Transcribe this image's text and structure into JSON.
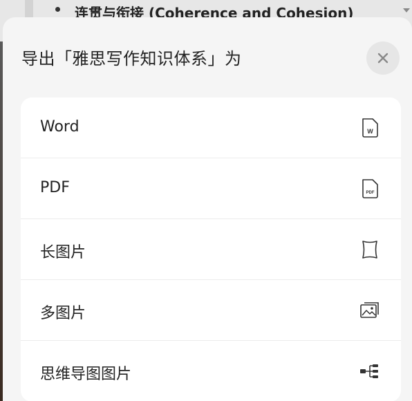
{
  "background": {
    "outline_item": "连贯与衔接 (Coherence and Cohesion)"
  },
  "sheet": {
    "title": "导出「雅思写作知识体系」为",
    "close_icon": "close-icon",
    "options": [
      {
        "label": "Word",
        "icon": "word-file-icon",
        "icon_text": "W"
      },
      {
        "label": "PDF",
        "icon": "pdf-file-icon",
        "icon_text": "PDF"
      },
      {
        "label": "长图片",
        "icon": "long-image-icon"
      },
      {
        "label": "多图片",
        "icon": "multi-image-icon"
      },
      {
        "label": "思维导图图片",
        "icon": "mindmap-image-icon"
      }
    ]
  },
  "colors": {
    "sheet_bg": "#f5f5f5",
    "card_bg": "#ffffff",
    "text": "#222222",
    "icon": "#333333"
  }
}
